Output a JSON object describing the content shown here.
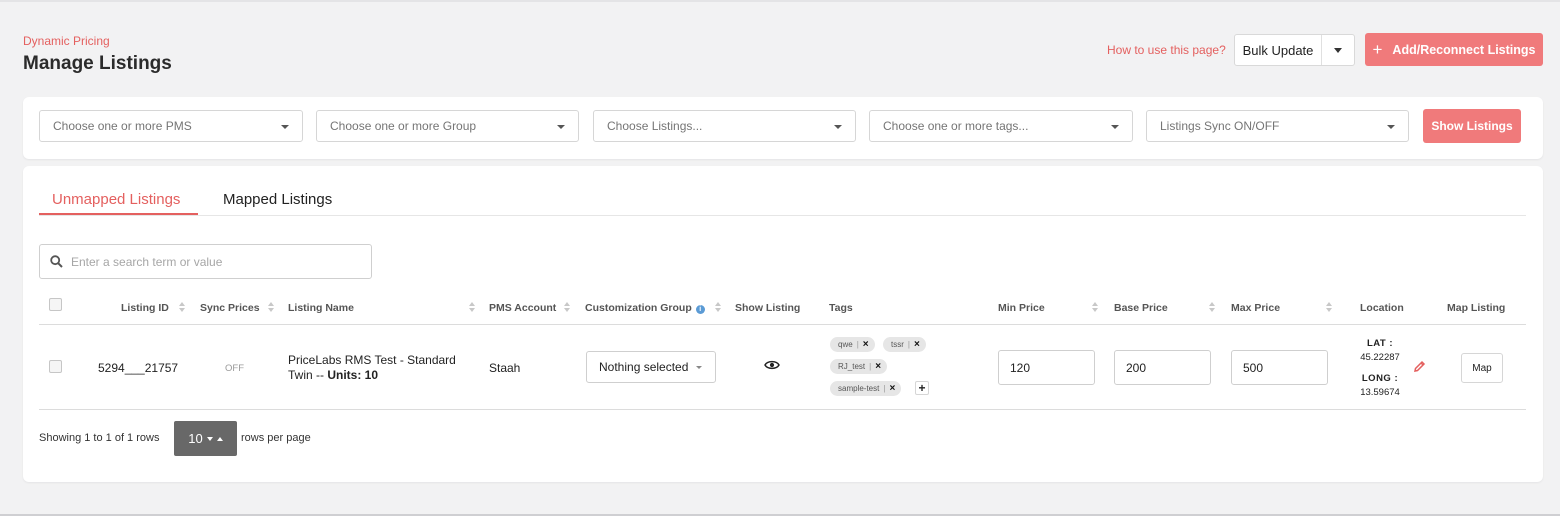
{
  "breadcrumb": "Dynamic Pricing",
  "page_title": "Manage Listings",
  "header": {
    "howto_link": "How to use this page?",
    "bulk_update_label": "Bulk Update",
    "add_reconnect_label": "Add/Reconnect Listings"
  },
  "filters": {
    "pms_placeholder": "Choose one or more PMS",
    "group_placeholder": "Choose one or more Group",
    "listings_placeholder": "Choose Listings...",
    "tags_placeholder": "Choose one or more tags...",
    "sync_placeholder": "Listings Sync ON/OFF",
    "show_button": "Show Listings"
  },
  "tabs": [
    {
      "label": "Unmapped Listings",
      "active": true
    },
    {
      "label": "Mapped Listings",
      "active": false
    }
  ],
  "search": {
    "placeholder": "Enter a search term or value"
  },
  "columns": {
    "listing_id": "Listing ID",
    "sync_prices": "Sync Prices",
    "listing_name": "Listing Name",
    "pms_account": "PMS Account",
    "customization_group": "Customization Group",
    "show_listing": "Show Listing",
    "tags": "Tags",
    "min_price": "Min Price",
    "base_price": "Base Price",
    "max_price": "Max Price",
    "location": "Location",
    "map_listing": "Map Listing"
  },
  "rows": [
    {
      "listing_id": "5294___21757",
      "sync_prices": "OFF",
      "listing_name_line1": "PriceLabs RMS Test - Standard",
      "listing_name_line2": "Twin -- ",
      "units_label": "Units: 10",
      "pms_account": "Staah",
      "customization_group": "Nothing selected",
      "tags": [
        "qwe",
        "tssr",
        "RJ_test",
        "sample-test"
      ],
      "min_price": "120",
      "base_price": "200",
      "max_price": "500",
      "lat_label": "LAT :",
      "lat_value": "45.22287",
      "long_label": "LONG :",
      "long_value": "13.59674",
      "map_button": "Map"
    }
  ],
  "footer": {
    "showing_text": "Showing 1 to 1 of 1 rows",
    "page_size": "10",
    "rows_per_page": "rows per page"
  },
  "colors": {
    "accent": "#f07a7b",
    "accent_text": "#e4605f",
    "background": "#f2f2f3",
    "pager": "#686868"
  },
  "icons": [
    "chevron-down-icon",
    "plus-icon",
    "search-icon",
    "sort-icon",
    "info-icon",
    "eye-icon",
    "close-icon",
    "pencil-icon"
  ]
}
